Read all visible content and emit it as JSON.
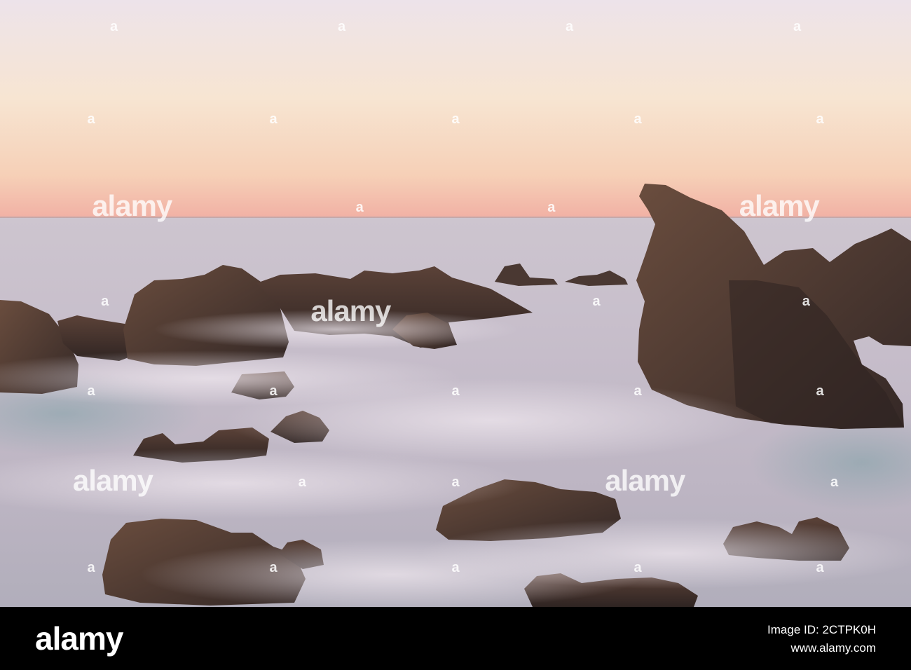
{
  "photo": {
    "subject": "rocky-coast-long-exposure-sunset",
    "colors": {
      "sky_top": "#ede3ea",
      "sky_mid": "#f6e4c9",
      "sky_horizon": "#f4b7a6",
      "sea": "#c9c3cf",
      "rock": "#3d2d28"
    }
  },
  "watermark": {
    "word": "alamy",
    "tick": "a"
  },
  "footer": {
    "logo": "alamy",
    "image_id_line": "Image ID: 2CTPK0H",
    "url": "www.alamy.com"
  }
}
